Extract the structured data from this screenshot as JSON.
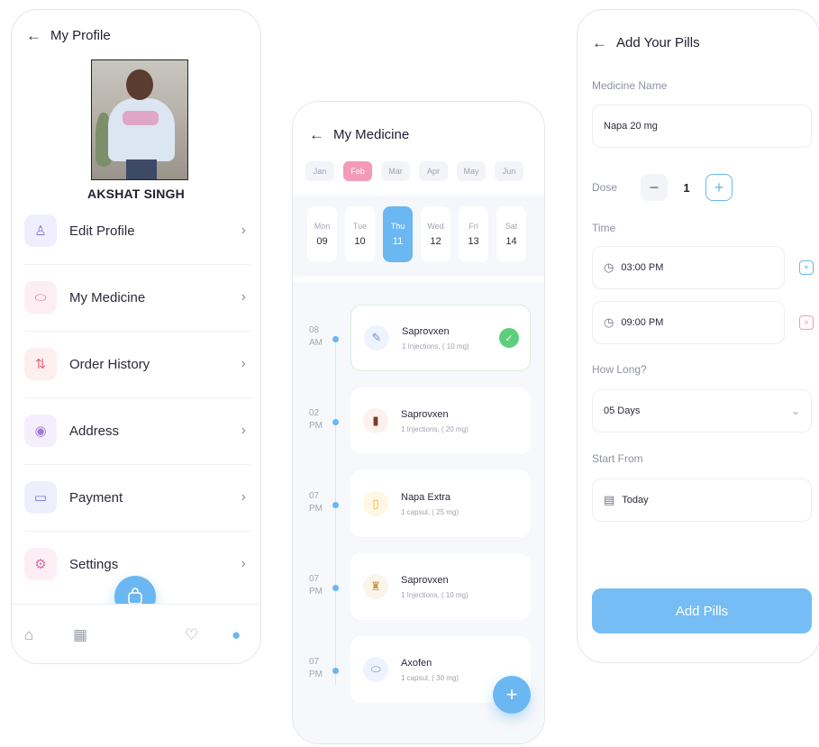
{
  "profile": {
    "title": "My Profile",
    "name": "AKSHAT SINGH",
    "menu": [
      {
        "label": "Edit Profile",
        "icon": "user-icon",
        "bg": "#efeefe",
        "fg": "#7d79d8"
      },
      {
        "label": "My Medicine",
        "icon": "pill-icon",
        "bg": "#fdeef4",
        "fg": "#e06f9b"
      },
      {
        "label": "Order History",
        "icon": "sort-arrows-icon",
        "bg": "#fdeef0",
        "fg": "#e0707c"
      },
      {
        "label": "Address",
        "icon": "location-pin-icon",
        "bg": "#f4eefd",
        "fg": "#a57ad8"
      },
      {
        "label": "Payment",
        "icon": "wallet-icon",
        "bg": "#eeeffd",
        "fg": "#7378d8"
      },
      {
        "label": "Settings",
        "icon": "gear-icon",
        "bg": "#fdeef6",
        "fg": "#d870a4"
      }
    ]
  },
  "medicine": {
    "title": "My Medicine",
    "months": [
      {
        "label": "Jan",
        "active": false
      },
      {
        "label": "Feb",
        "active": true
      },
      {
        "label": "Mar",
        "active": false
      },
      {
        "label": "Apr",
        "active": false
      },
      {
        "label": "May",
        "active": false
      },
      {
        "label": "Jun",
        "active": false
      }
    ],
    "days": [
      {
        "name": "Mon",
        "date": "09",
        "active": false
      },
      {
        "name": "Tue",
        "date": "10",
        "active": false
      },
      {
        "name": "Thu",
        "date": "11",
        "active": true
      },
      {
        "name": "Wed",
        "date": "12",
        "active": false
      },
      {
        "name": "Fri",
        "date": "13",
        "active": false
      },
      {
        "name": "Sat",
        "date": "14",
        "active": false
      }
    ],
    "schedule": [
      {
        "hour": "08",
        "ampm": "AM",
        "name": "Saprovxen",
        "desc": "1 Injections, ( 10 mg)",
        "icon": "syringe-icon",
        "done": true
      },
      {
        "hour": "02",
        "ampm": "PM",
        "name": "Saprovxen",
        "desc": "1 Injections, ( 20 mg)",
        "icon": "bottle-icon",
        "done": false
      },
      {
        "hour": "07",
        "ampm": "PM",
        "name": "Napa Extra",
        "desc": "1 capsul, ( 25 mg)",
        "icon": "capsule-icon",
        "done": false
      },
      {
        "hour": "07",
        "ampm": "PM",
        "name": "Saprovxen",
        "desc": "1 Injections, ( 10 mg)",
        "icon": "vial-icon",
        "done": false
      },
      {
        "hour": "07",
        "ampm": "PM",
        "name": "Axofen",
        "desc": "1 capsul, ( 30 mg)",
        "icon": "pill-icon",
        "done": false
      }
    ]
  },
  "add_pills": {
    "title": "Add Your Pills",
    "medicine_name_label": "Medicine Name",
    "medicine_name_value": "Napa 20 mg",
    "dose_label": "Dose",
    "dose_value": "1",
    "time_label": "Time",
    "times": [
      "03:00 PM",
      "09:00 PM"
    ],
    "how_long_label": "How Long?",
    "how_long_value": "05 Days",
    "start_from_label": "Start From",
    "start_from_value": "Today",
    "submit_label": "Add Pills"
  },
  "colors": {
    "accent": "#6bb7f2",
    "pink": "#f49ab8",
    "success": "#5ccf7a"
  }
}
